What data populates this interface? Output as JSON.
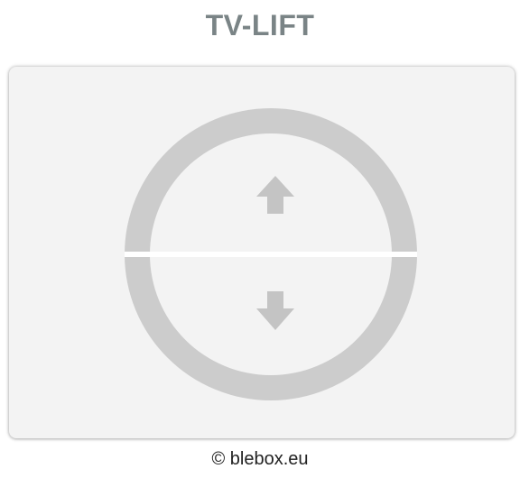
{
  "header": {
    "title": "TV-LIFT"
  },
  "controls": {
    "up_icon": "arrow-up-icon",
    "down_icon": "arrow-down-icon"
  },
  "colors": {
    "title": "#7a8486",
    "card_background": "#f3f3f3",
    "ring": "#cccccc",
    "button_fill": "#f3f3f3",
    "arrow": "#c4c4c4",
    "divider": "#ffffff"
  },
  "footer": {
    "copyright": "© blebox.eu"
  }
}
